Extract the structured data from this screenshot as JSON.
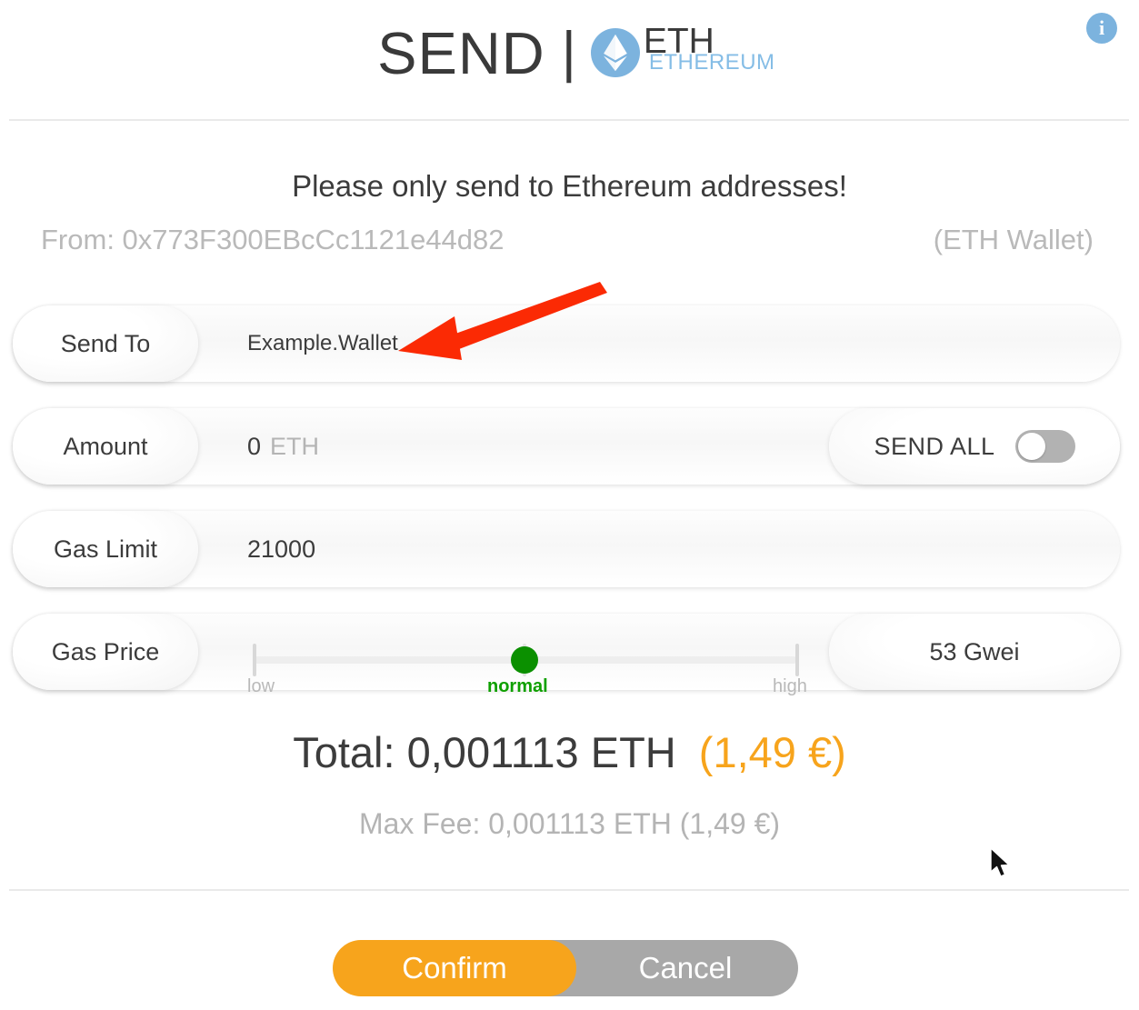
{
  "header": {
    "action_title": "SEND",
    "separator": "|",
    "coin_ticker": "ETH",
    "coin_name": "ETHEREUM",
    "coin_icon": "ethereum-diamond-icon",
    "info_icon": "info-icon",
    "info_label": "i",
    "logo_circle_color": "#7cb3de",
    "coin_name_color": "#85bde6"
  },
  "notice": {
    "text": "Please only send to Ethereum addresses!"
  },
  "from": {
    "prefix": "From:",
    "address": "0x773F300EBcCc1121e44d82",
    "full_line": "From: 0x773F300EBcCc1121e44d82",
    "wallet_label": "(ETH Wallet)"
  },
  "form": {
    "send_to": {
      "label": "Send To",
      "value": "Example.Wallet",
      "placeholder": "Send To"
    },
    "amount": {
      "label": "Amount",
      "value": "0",
      "unit": "ETH",
      "send_all_label": "SEND ALL",
      "send_all_state": "off"
    },
    "gas_limit": {
      "label": "Gas Limit",
      "value": "21000"
    },
    "gas_price": {
      "label": "Gas Price",
      "tick_low": "low",
      "tick_normal": "normal",
      "tick_high": "high",
      "selected_tier": "normal",
      "value": "53 Gwei",
      "knob_color": "#0b9000"
    }
  },
  "totals": {
    "total_prefix": "Total:",
    "total_crypto": "0,001113 ETH",
    "total_fiat": "(1,49 €)",
    "total_fiat_color": "#f7a41c",
    "max_fee": "Max Fee: 0,001113 ETH (1,49 €)"
  },
  "actions": {
    "confirm_label": "Confirm",
    "confirm_color": "#f7a41c",
    "cancel_label": "Cancel",
    "cancel_color": "#a8a8a8"
  },
  "annotation": {
    "arrow_color": "#fb2a04",
    "arrow_points_to": "Example.Wallet"
  }
}
